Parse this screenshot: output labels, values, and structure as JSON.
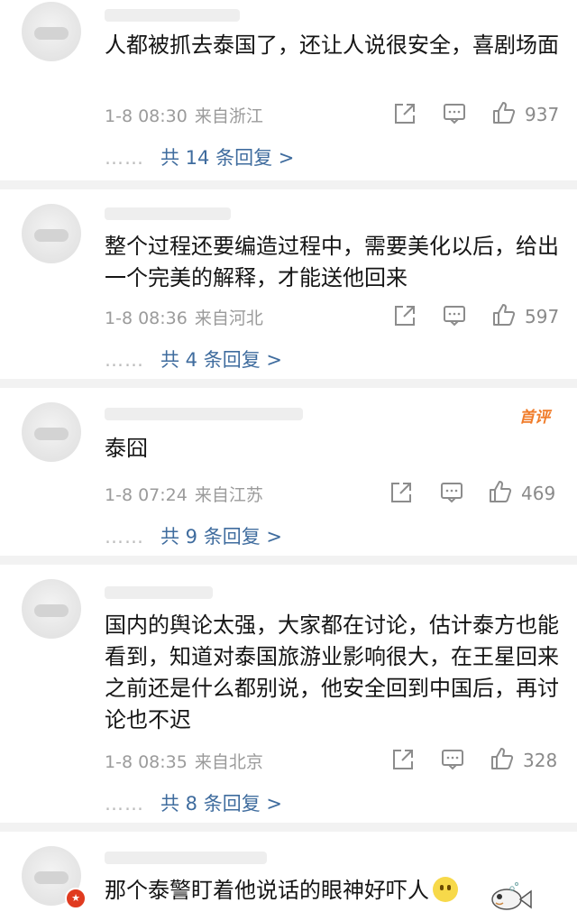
{
  "comments": [
    {
      "text": "人都被抓去泰国了，还让人说很安全，喜剧场面",
      "time": "1-8 08:30",
      "location": "来自浙江",
      "likes": "937",
      "replies": "共 14 条回复 >"
    },
    {
      "text": "整个过程还要编造过程中，需要美化以后，给出一个完美的解释，才能送他回来",
      "time": "1-8 08:36",
      "location": "来自河北",
      "likes": "597",
      "replies": "共 4 条回复 >"
    },
    {
      "badge": "首评",
      "text": "泰囧",
      "time": "1-8 07:24",
      "location": "来自江苏",
      "likes": "469",
      "replies": "共 9 条回复 >"
    },
    {
      "text": "国内的舆论太强，大家都在讨论，估计泰方也能看到，知道对泰国旅游业影响很大，在王星回来之前还是什么都别说，他安全回到中国后，再讨论也不迟",
      "time": "1-8 08:35",
      "location": "来自北京",
      "likes": "328",
      "replies": "共 8 条回复 >"
    },
    {
      "text": "那个泰警盯着他说话的眼神好吓人"
    }
  ],
  "reply_dots": "……",
  "icons": {
    "share": "share-icon",
    "comment": "comment-icon",
    "like": "thumbs-up-icon"
  },
  "colors": {
    "reply_link": "#3f6c9e",
    "meta": "#9b9b9b",
    "badge": "#f07c2a",
    "divider": "#f2f2f2"
  }
}
